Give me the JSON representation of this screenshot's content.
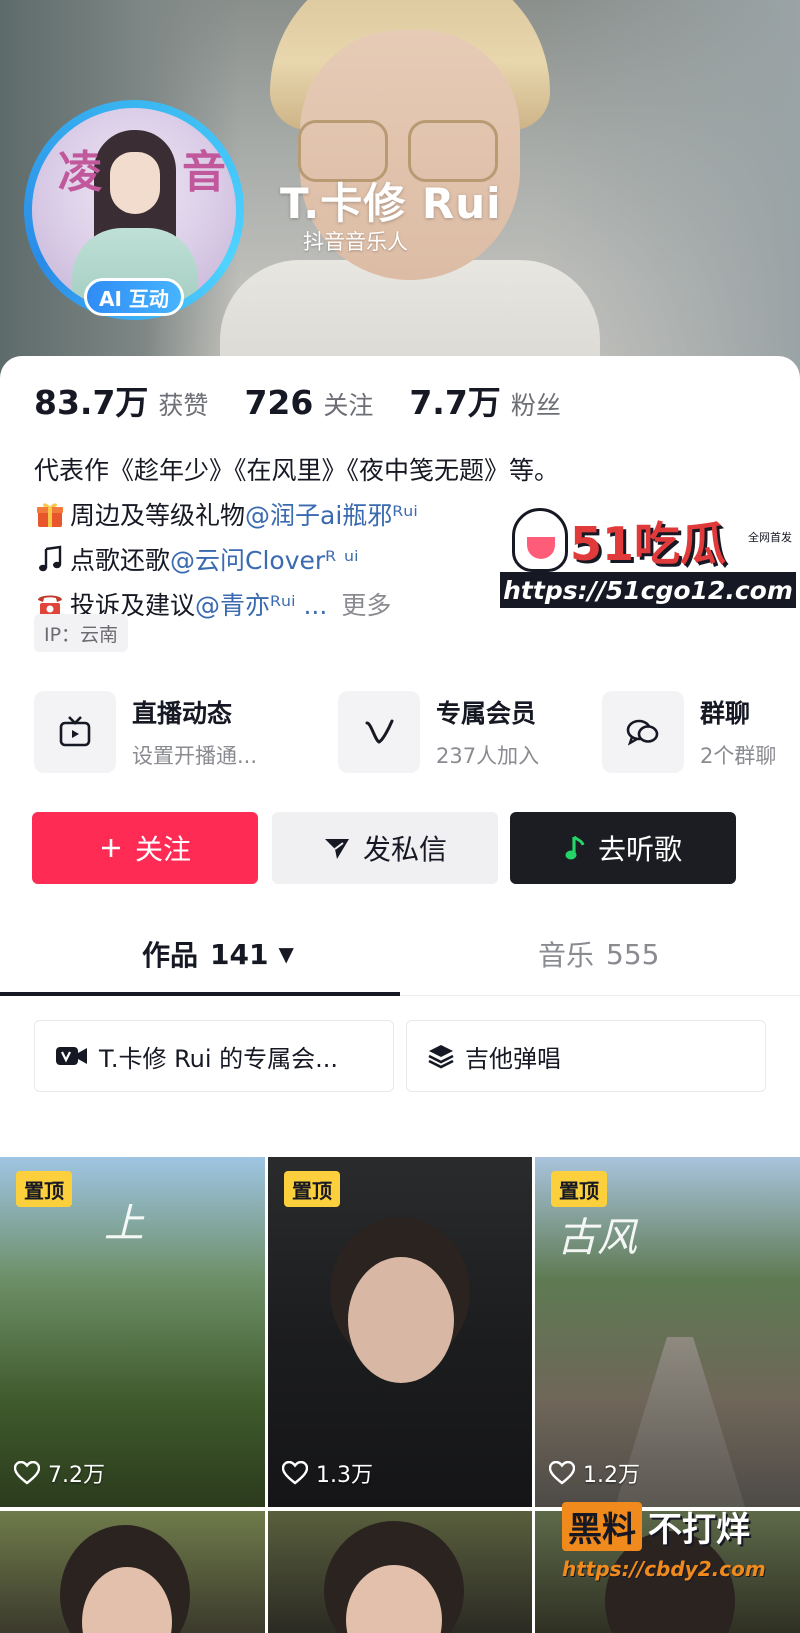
{
  "profile": {
    "name": "T.卡修 Rui",
    "subtitle": "抖音音乐人",
    "avatar_badge": "AI 互动",
    "avatar_calligraphy": [
      "凌",
      "音"
    ]
  },
  "stats": [
    {
      "value": "83.7万",
      "label": "获赞"
    },
    {
      "value": "726",
      "label": "关注"
    },
    {
      "value": "7.7万",
      "label": "粉丝"
    }
  ],
  "bio": {
    "line1": "代表作《趁年少》《在风里》《夜中笺无题》等。",
    "line2_text": "周边及等级礼物",
    "line2_mention": "@润子ai瓶邪ᴿᵘⁱ",
    "line3_text": "点歌还歌",
    "line3_mention": "@云问Cloverᴿ ᵘⁱ",
    "line4_text": "投诉及建议",
    "line4_mention": "@青亦ᴿᵘⁱ ...",
    "more": "更多"
  },
  "ip_tag": "IP：云南",
  "services": [
    {
      "title": "直播动态",
      "sub": "设置开播通...",
      "icon": "tv-icon"
    },
    {
      "title": "专属会员",
      "sub": "237人加入",
      "icon": "v-badge-icon"
    },
    {
      "title": "群聊",
      "sub": "2个群聊",
      "icon": "chat-bubbles-icon"
    }
  ],
  "actions": {
    "follow": "关注",
    "message": "发私信",
    "music": "去听歌"
  },
  "tabs": {
    "works_label": "作品",
    "works_count": "141",
    "music_label": "音乐",
    "music_count": "555"
  },
  "collections": [
    {
      "label": "T.卡修 Rui 的专属会...",
      "icon": "video-member-icon"
    },
    {
      "label": "吉他弹唱",
      "icon": "layers-icon"
    }
  ],
  "videos": [
    {
      "pinned": "置顶",
      "likes": "7.2万",
      "overlay": "上"
    },
    {
      "pinned": "置顶",
      "likes": "1.3万",
      "overlay": ""
    },
    {
      "pinned": "置顶",
      "likes": "1.2万",
      "overlay": "古风"
    }
  ],
  "watermarks": {
    "site1_logo": "51吃瓜",
    "site1_tag": "全网首发",
    "site1_url": "https://51cgo12.com",
    "site2_box": "黑料",
    "site2_text": "不打烊",
    "site2_url": "https://cbdy2.com"
  },
  "colors": {
    "follow_button": "#fe2c55",
    "music_button": "#1b1d23",
    "mention": "#3a6ab0",
    "pin_badge": "#fccf3c",
    "avatar_ring": "#39b6f0"
  }
}
